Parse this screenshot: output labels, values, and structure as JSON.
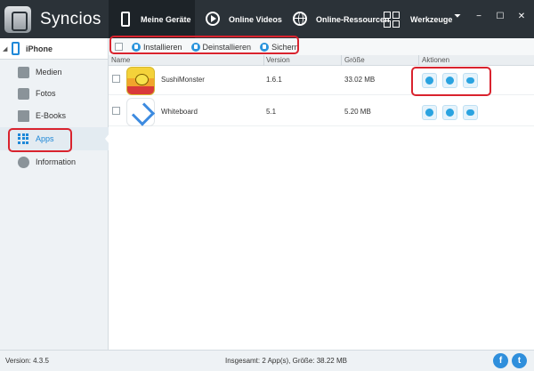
{
  "app": {
    "title": "Syncios",
    "version_label": "Version: 4.3.5"
  },
  "nav": {
    "tabs": [
      {
        "label": "Meine Geräte",
        "icon": "phone-icon",
        "active": true
      },
      {
        "label": "Online Videos",
        "icon": "play-icon"
      },
      {
        "label": "Online-Ressourcen",
        "icon": "globe-icon"
      },
      {
        "label": "Werkzeuge",
        "icon": "toolbox-icon"
      }
    ],
    "window_controls": [
      "⏷",
      "−",
      "☐",
      "✕"
    ]
  },
  "sidebar": {
    "device_name": "iPhone",
    "items": [
      {
        "label": "Medien",
        "icon": "media-icon"
      },
      {
        "label": "Fotos",
        "icon": "photos-icon"
      },
      {
        "label": "E-Books",
        "icon": "ebooks-icon"
      },
      {
        "label": "Apps",
        "icon": "apps-icon",
        "active": true
      },
      {
        "label": "Information",
        "icon": "info-icon"
      }
    ]
  },
  "toolbar": {
    "install_label": "Installieren",
    "uninstall_label": "Deinstallieren",
    "backup_label": "Sichern"
  },
  "table": {
    "headers": {
      "name": "Name",
      "version": "Version",
      "size": "Größe",
      "actions": "Aktionen"
    },
    "rows": [
      {
        "name": "SushiMonster",
        "version": "1.6.1",
        "size": "33.02 MB",
        "icon": "sushimonster-app-icon"
      },
      {
        "name": "Whiteboard",
        "version": "5.1",
        "size": "5.20 MB",
        "icon": "whiteboard-app-icon"
      }
    ]
  },
  "status": {
    "total_text": "Insgesamt: 2 App(s), Größe: 38.22 MB",
    "facebook_glyph": "f",
    "twitter_glyph": "t"
  },
  "colors": {
    "accent": "#1e88d8",
    "highlight": "#d9232e",
    "titlebar": "#2b3238"
  }
}
